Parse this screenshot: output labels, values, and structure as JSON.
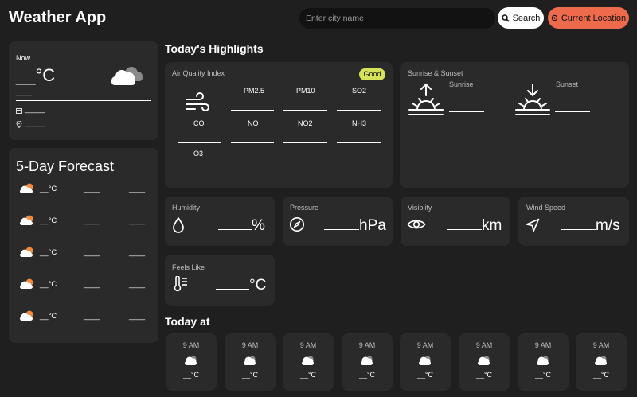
{
  "app": {
    "title": "Weather App"
  },
  "search": {
    "placeholder": "Enter city name",
    "button_label": "Search",
    "location_label": "Current Location"
  },
  "colors": {
    "accent": "#ee6a4c",
    "good_badge": "#d6e35a",
    "card": "#2a2a2b",
    "background": "#1f1f20"
  },
  "now": {
    "label": "Now",
    "temp": "__°C",
    "icon": "cloud-icon",
    "description": "____",
    "date": "_____",
    "location": "_____"
  },
  "forecast": {
    "title": "5-Day Forecast",
    "days": [
      {
        "temp": "__°C",
        "date": "____",
        "day": "____",
        "icon": "cloud-sun-icon"
      },
      {
        "temp": "__°C",
        "date": "____",
        "day": "____",
        "icon": "cloud-sun-icon"
      },
      {
        "temp": "__°C",
        "date": "____",
        "day": "____",
        "icon": "cloud-sun-icon"
      },
      {
        "temp": "__°C",
        "date": "____",
        "day": "____",
        "icon": "cloud-sun-icon"
      },
      {
        "temp": "__°C",
        "date": "____",
        "day": "____",
        "icon": "cloud-sun-icon"
      }
    ]
  },
  "highlights": {
    "title": "Today's Highlights",
    "aqi": {
      "title": "Air Quality Index",
      "badge": "Good",
      "row1": [
        "PM2.5",
        "PM10",
        "SO2"
      ],
      "row2": [
        "CO",
        "NO",
        "NO2",
        "NH3"
      ],
      "row3": [
        "O3"
      ]
    },
    "sun": {
      "title": "Sunrise & Sunset",
      "sunrise_label": "Sunrise",
      "sunset_label": "Sunset"
    },
    "humidity": {
      "title": "Humidity",
      "unit": "%"
    },
    "pressure": {
      "title": "Pressure",
      "unit": "hPa"
    },
    "visibility": {
      "title": "Visiblity",
      "unit": "km"
    },
    "wind": {
      "title": "Wind Speed",
      "unit": "m/s"
    },
    "feels": {
      "title": "Feels Like",
      "unit": "°C"
    }
  },
  "today": {
    "title": "Today at",
    "hours": [
      {
        "time": "9 AM",
        "temp": "__°C"
      },
      {
        "time": "9 AM",
        "temp": "__°C"
      },
      {
        "time": "9 AM",
        "temp": "__°C"
      },
      {
        "time": "9 AM",
        "temp": "__°C"
      },
      {
        "time": "9 AM",
        "temp": "__°C"
      },
      {
        "time": "9 AM",
        "temp": "__°C"
      },
      {
        "time": "9 AM",
        "temp": "__°C"
      },
      {
        "time": "9 AM",
        "temp": "__°C"
      }
    ]
  }
}
